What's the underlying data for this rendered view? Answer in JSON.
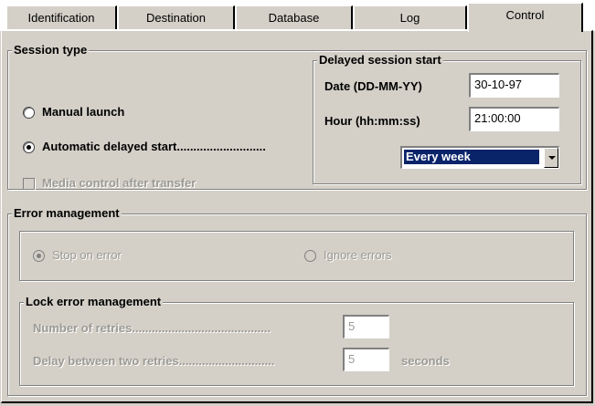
{
  "tabs": [
    {
      "label": "Identification"
    },
    {
      "label": "Destination"
    },
    {
      "label": "Database"
    },
    {
      "label": "Log"
    },
    {
      "label": "Control"
    }
  ],
  "active_tab": "Control",
  "session_type": {
    "title": "Session type",
    "manual_launch_label": "Manual launch",
    "automatic_delayed_start_label": "Automatic delayed start...........................",
    "selected": "automatic_delayed_start",
    "media_control_label": "Media control after transfer",
    "media_control_checked": false,
    "media_control_enabled": false
  },
  "delayed_session_start": {
    "title": "Delayed session start",
    "date_label": "Date (DD-MM-YY)",
    "date_value": "30-10-97",
    "hour_label": "Hour (hh:mm:ss)",
    "hour_value": "21:00:00",
    "frequency_value": "Every week"
  },
  "error_management": {
    "title": "Error management",
    "stop_on_error_label": "Stop on error",
    "ignore_errors_label": "Ignore errors",
    "selected": "stop_on_error",
    "enabled": false
  },
  "lock_error_management": {
    "title": "Lock error management",
    "retries_label": "Number of retries..........................................",
    "retries_value": "5",
    "delay_label": "Delay between two retries.............................",
    "delay_value": "5",
    "delay_unit": "seconds",
    "enabled": false
  },
  "colors": {
    "face": "#d4d0c8",
    "highlight": "#0a246a",
    "disabled_text": "#9c9a94"
  }
}
